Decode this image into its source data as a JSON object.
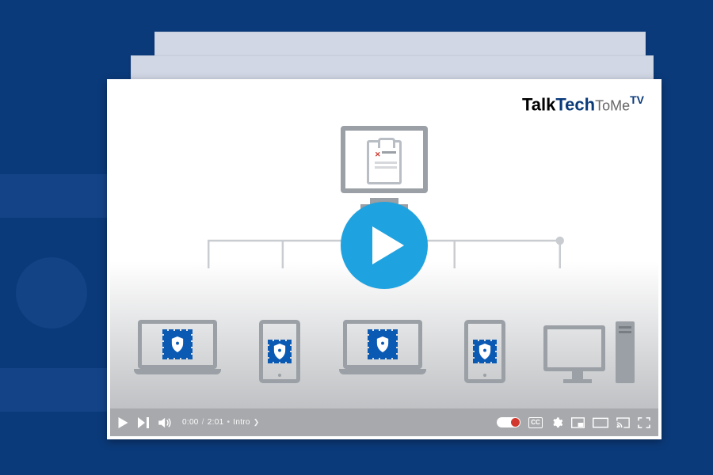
{
  "brand": {
    "p1": "Talk",
    "p2": "Tech",
    "p3": "ToMe",
    "p4": "TV"
  },
  "player": {
    "current_time": "0:00",
    "duration": "2:01",
    "chapter": "Intro",
    "cc_label": "CC",
    "autoplay_on": true
  },
  "icons": {
    "play": "play-icon",
    "next": "next-icon",
    "volume": "volume-icon",
    "gear": "gear-icon",
    "miniplayer": "miniplayer-icon",
    "theater": "theater-icon",
    "cast": "cast-icon",
    "fullscreen": "fullscreen-icon",
    "server": "server-monitor-icon",
    "clipboard": "clipboard-icon",
    "shield": "shield-icon",
    "laptop": "laptop-icon",
    "tablet": "tablet-icon",
    "desktop": "desktop-icon",
    "big_play": "big-play-icon"
  },
  "colors": {
    "page_bg": "#0b3a7a",
    "play_button": "#1ea3e0",
    "badge": "#0a5ab4",
    "device_line": "#9aa0a6",
    "autoplay_knob": "#d1382e"
  }
}
